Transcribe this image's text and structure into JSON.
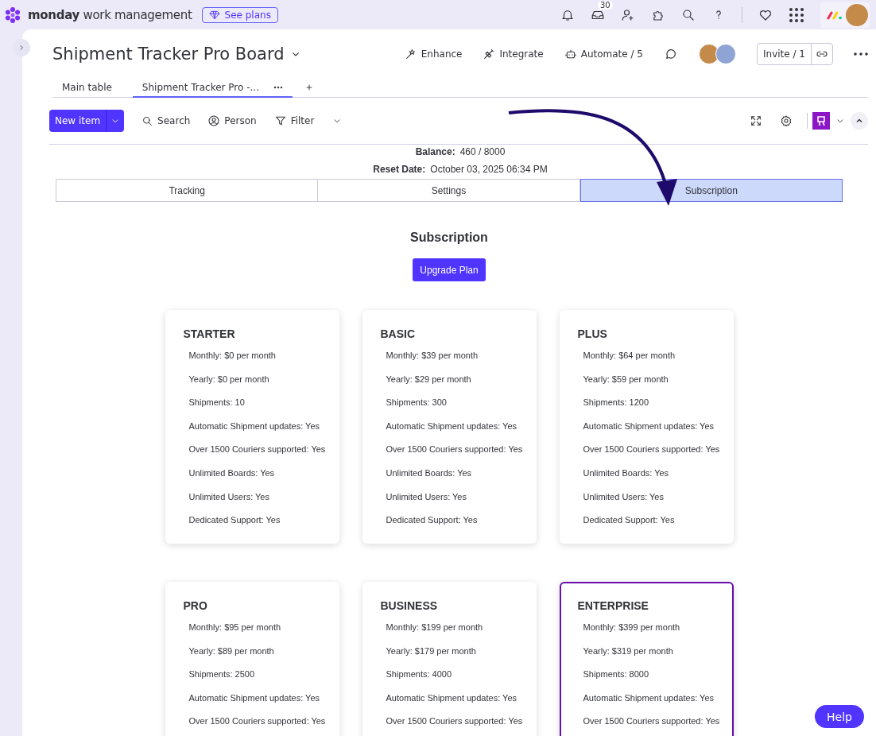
{
  "topbar": {
    "brand_bold": "monday",
    "brand_rest": "work management",
    "see_plans": "See plans",
    "inbox_badge": "30"
  },
  "board": {
    "title": "Shipment Tracker Pro Board",
    "tabs": [
      {
        "label": "Main table",
        "selected": false
      },
      {
        "label": "Shipment Tracker Pro -...",
        "selected": true
      }
    ],
    "actions": [
      "Enhance",
      "Integrate",
      "Automate / 5"
    ],
    "invite": "Invite / 1"
  },
  "toolbar": {
    "new_item": "New item",
    "search": "Search",
    "person": "Person",
    "filter": "Filter"
  },
  "account": [
    {
      "label": "Balance:",
      "value": "460 / 8000"
    },
    {
      "label": "Reset Date:",
      "value": "October 03, 2025 06:34 PM"
    }
  ],
  "view_tabs": [
    {
      "label": "Tracking",
      "selected": false
    },
    {
      "label": "Settings",
      "selected": false
    },
    {
      "label": "Subscription",
      "selected": true
    }
  ],
  "subscription": {
    "heading": "Subscription",
    "upgrade": "Upgrade Plan",
    "plans": [
      {
        "name": "STARTER",
        "selected": false,
        "features": [
          "Monthly: $0 per month",
          "Yearly: $0 per month",
          "Shipments: 10",
          "Automatic Shipment updates: Yes",
          "Over 1500 Couriers supported: Yes",
          "Unlimited Boards: Yes",
          "Unlimited Users: Yes",
          "Dedicated Support: Yes"
        ]
      },
      {
        "name": "BASIC",
        "selected": false,
        "features": [
          "Monthly: $39 per month",
          "Yearly: $29 per month",
          "Shipments: 300",
          "Automatic Shipment updates: Yes",
          "Over 1500 Couriers supported: Yes",
          "Unlimited Boards: Yes",
          "Unlimited Users: Yes",
          "Dedicated Support: Yes"
        ]
      },
      {
        "name": "PLUS",
        "selected": false,
        "features": [
          "Monthly: $64 per month",
          "Yearly: $59 per month",
          "Shipments: 1200",
          "Automatic Shipment updates: Yes",
          "Over 1500 Couriers supported: Yes",
          "Unlimited Boards: Yes",
          "Unlimited Users: Yes",
          "Dedicated Support: Yes"
        ]
      },
      {
        "name": "PRO",
        "selected": false,
        "features": [
          "Monthly: $95 per month",
          "Yearly: $89 per month",
          "Shipments: 2500",
          "Automatic Shipment updates: Yes",
          "Over 1500 Couriers supported: Yes"
        ]
      },
      {
        "name": "BUSINESS",
        "selected": false,
        "features": [
          "Monthly: $199 per month",
          "Yearly: $179 per month",
          "Shipments: 4000",
          "Automatic Shipment updates: Yes",
          "Over 1500 Couriers supported: Yes"
        ]
      },
      {
        "name": "ENTERPRISE",
        "selected": true,
        "features": [
          "Monthly: $399 per month",
          "Yearly: $319 per month",
          "Shipments: 8000",
          "Automatic Shipment updates: Yes",
          "Over 1500 Couriers supported: Yes"
        ]
      }
    ]
  },
  "help": "Help"
}
